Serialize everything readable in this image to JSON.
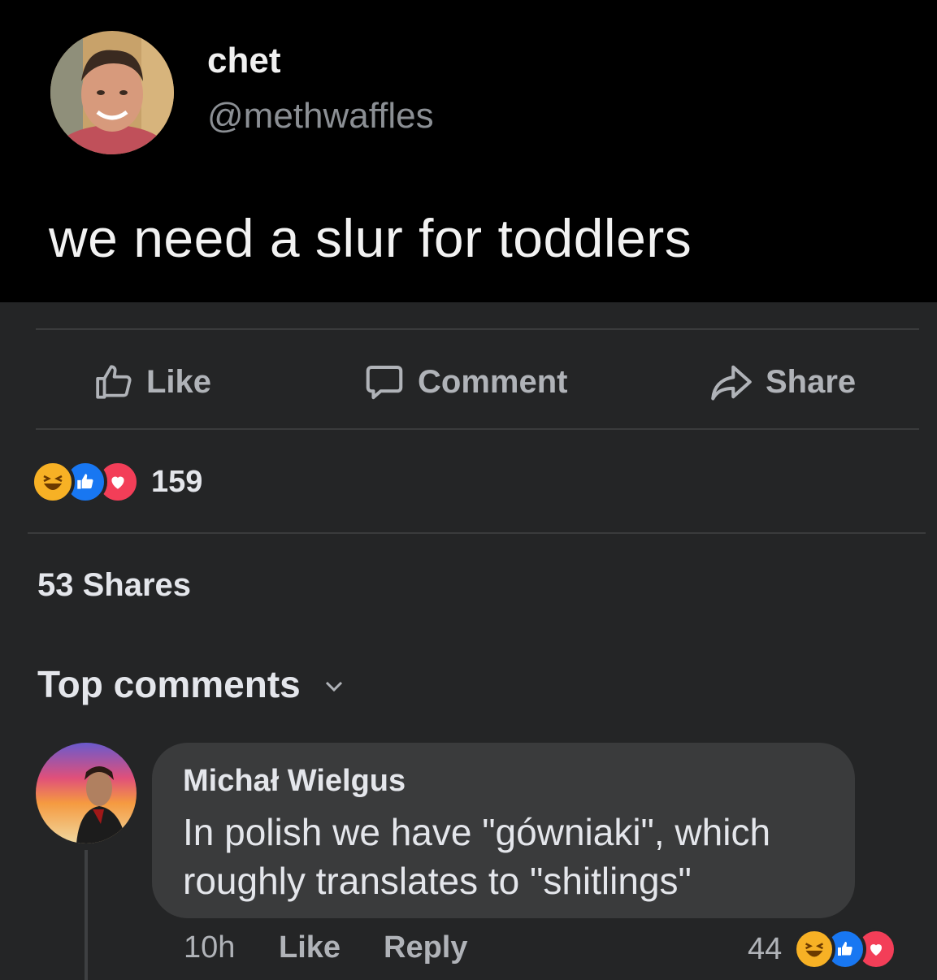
{
  "post": {
    "author_name": "chet",
    "author_handle": "@methwaffles",
    "text": "we need a slur for toddlers"
  },
  "actions": {
    "like": "Like",
    "comment": "Comment",
    "share": "Share"
  },
  "reactions": {
    "icons": [
      "haha-icon",
      "like-icon",
      "love-icon"
    ],
    "count": "159"
  },
  "shares": "53 Shares",
  "comments_header": "Top comments",
  "comment": {
    "author": "Michał Wielgus",
    "text": "In polish we have \"gówniaki\", which roughly translates to \"shitlings\"",
    "time": "10h",
    "like_label": "Like",
    "reply_label": "Reply",
    "reaction_count": "44",
    "reaction_icons": [
      "haha-icon",
      "like-icon",
      "love-icon"
    ]
  },
  "colors": {
    "background": "#242526",
    "tweet_background": "#000000",
    "like_blue": "#1877f2",
    "love_red": "#f33e58",
    "haha_yellow": "#f7b125"
  }
}
